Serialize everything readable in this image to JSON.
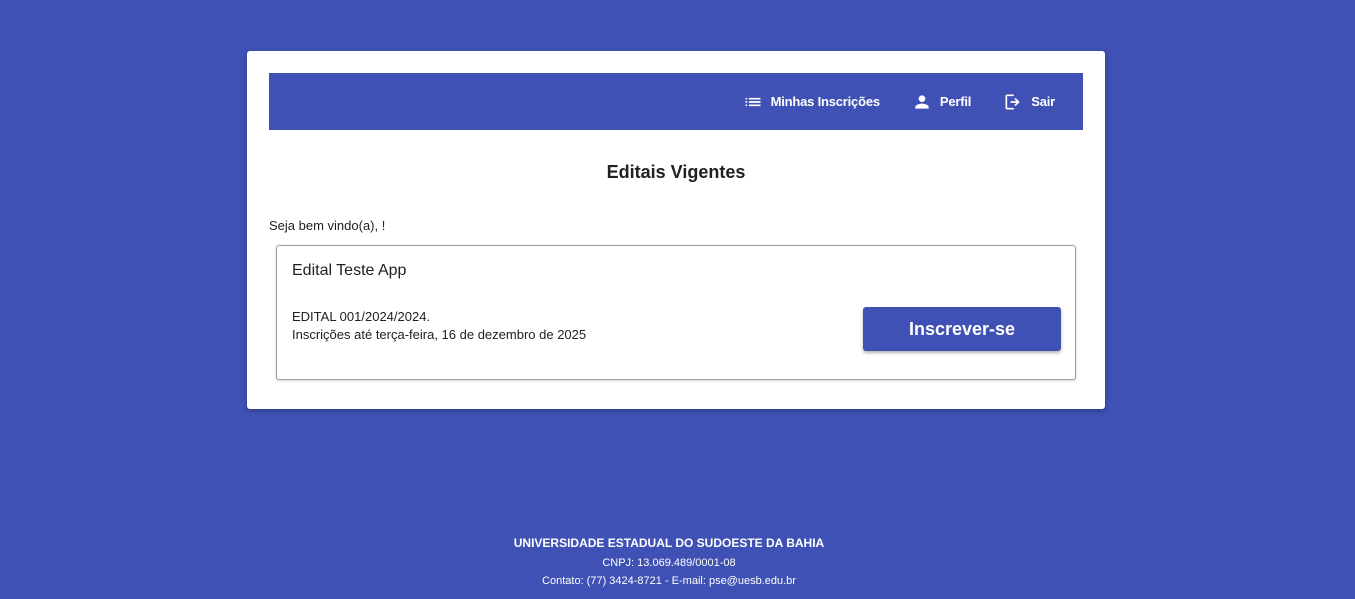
{
  "nav": {
    "items": [
      {
        "label": "Minhas Inscrições",
        "icon": "list-icon"
      },
      {
        "label": "Perfil",
        "icon": "person-icon"
      },
      {
        "label": "Sair",
        "icon": "logout-icon"
      }
    ]
  },
  "main": {
    "title": "Editais Vigentes",
    "welcome": "Seja bem vindo(a), !"
  },
  "edital": {
    "title": "Edital Teste App",
    "code": "EDITAL 001/2024/2024.",
    "deadline": "Inscrições até terça-feira, 16 de dezembro de 2025",
    "button_label": "Inscrever-se"
  },
  "footer": {
    "university": "UNIVERSIDADE ESTADUAL DO SUDOESTE DA BAHIA",
    "cnpj": "CNPJ: 13.069.489/0001-08",
    "contact": "Contato: (77) 3424-8721 - E-mail: pse@uesb.edu.br"
  },
  "colors": {
    "primary": "#3f51b5",
    "surface": "#ffffff",
    "text": "#212121"
  }
}
